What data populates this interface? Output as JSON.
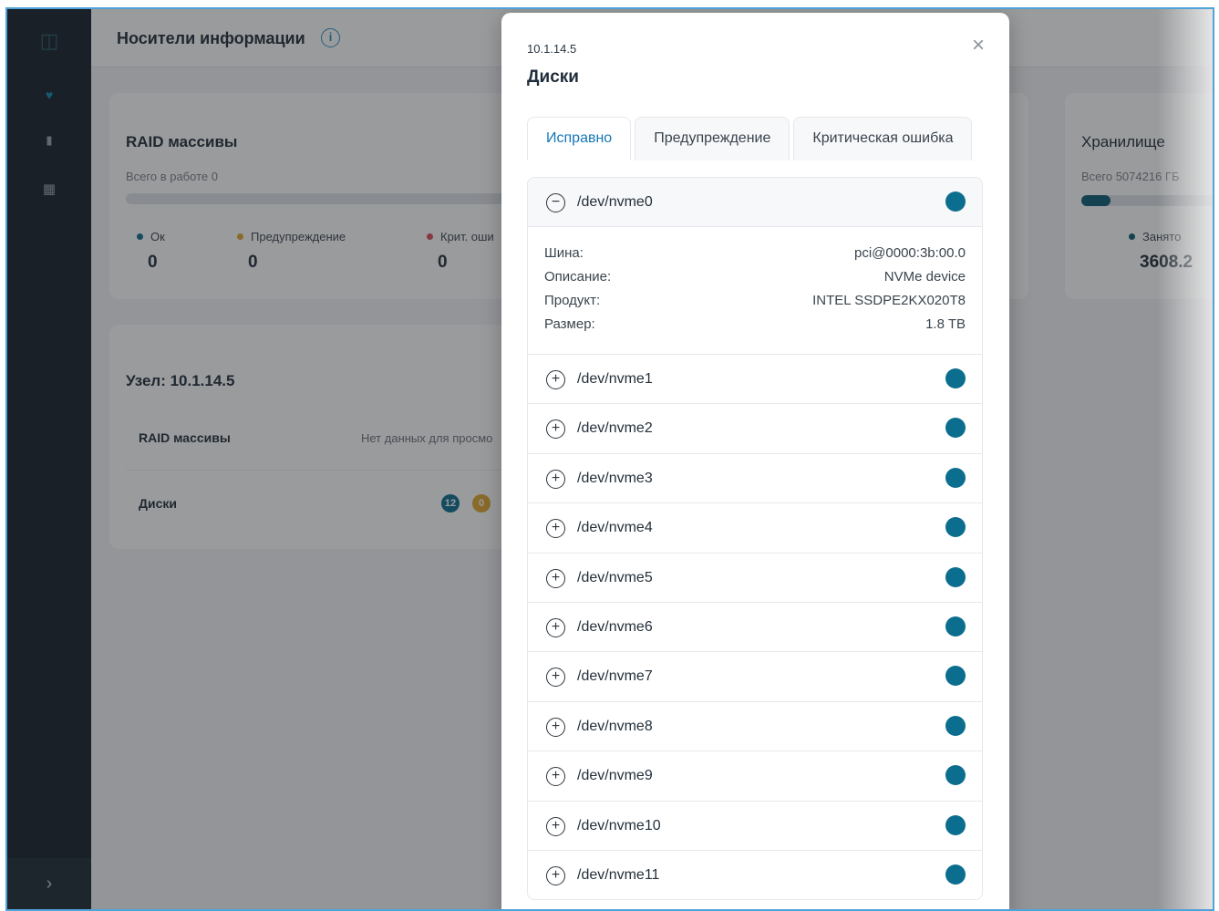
{
  "app": {
    "page_title": "Носители информации",
    "icons": {
      "logo": "map-logo-icon",
      "health": "heart-pulse-icon",
      "stats": "bar-chart-icon",
      "calendar": "calendar-icon",
      "expand": "chevron-right-icon",
      "info": "info-icon"
    }
  },
  "raid_card": {
    "title": "RAID массивы",
    "subtitle": "Всего в работе 0",
    "stats": [
      {
        "label": "Ок",
        "value": "0",
        "color": "#0c6e8f"
      },
      {
        "label": "Предупреждение",
        "value": "0",
        "color": "#e0a82e"
      },
      {
        "label": "Крит. оши",
        "value": "0",
        "color": "#d94b58"
      }
    ]
  },
  "storage_card": {
    "title": "Хранилище",
    "subtitle": "Всего 5074216 ГБ",
    "used_label": "Занято",
    "used_value": "3608.2",
    "used_fraction": 0.18
  },
  "node_card": {
    "title": "Узел: 10.1.14.5",
    "rows": [
      {
        "label": "RAID массивы",
        "value": "Нет данных для просмо"
      },
      {
        "label": "Диски",
        "badge_ok": "12",
        "badge_warn": "0"
      }
    ]
  },
  "modal": {
    "host": "10.1.14.5",
    "title": "Диски",
    "close_label": "×",
    "tabs": [
      {
        "label": "Исправно",
        "active": true
      },
      {
        "label": "Предупреждение",
        "active": false
      },
      {
        "label": "Критическая ошибка",
        "active": false
      }
    ],
    "status_color": "#0c6e8f",
    "disks": [
      {
        "name": "/dev/nvme0",
        "expanded": true
      },
      {
        "name": "/dev/nvme1"
      },
      {
        "name": "/dev/nvme2"
      },
      {
        "name": "/dev/nvme3"
      },
      {
        "name": "/dev/nvme4"
      },
      {
        "name": "/dev/nvme5"
      },
      {
        "name": "/dev/nvme6"
      },
      {
        "name": "/dev/nvme7"
      },
      {
        "name": "/dev/nvme8"
      },
      {
        "name": "/dev/nvme9"
      },
      {
        "name": "/dev/nvme10"
      },
      {
        "name": "/dev/nvme11"
      }
    ],
    "details": [
      {
        "label": "Шина:",
        "value": "pci@0000:3b:00.0"
      },
      {
        "label": "Описание:",
        "value": "NVMe device"
      },
      {
        "label": "Продукт:",
        "value": "INTEL SSDPE2KX020T8"
      },
      {
        "label": "Размер:",
        "value": "1.8 TB"
      }
    ]
  }
}
